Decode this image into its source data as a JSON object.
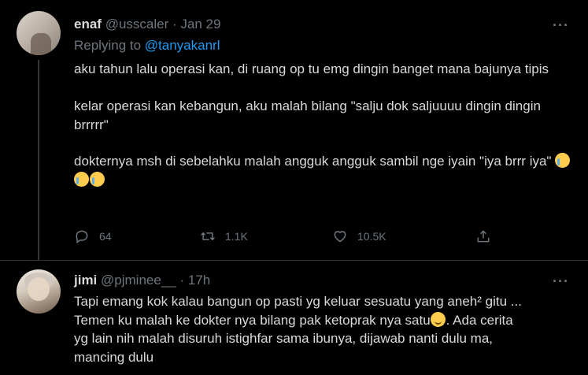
{
  "tweet1": {
    "name": "enaf",
    "handle": "@usscaler",
    "dot": "·",
    "time": "Jan 29",
    "replying_prefix": "Replying to",
    "replying_mention": "@tanyakanrl",
    "para1": "aku tahun lalu operasi kan, di ruang op tu emg dingin banget mana bajunya tipis",
    "para2": "kelar operasi kan kebangun, aku malah bilang \"salju dok saljuuuu dingin dingin brrrrr\"",
    "para3": "dokternya msh di sebelahku malah angguk angguk sambil nge iyain \"iya brrr iya\"",
    "more": "···",
    "counts": {
      "replies": "64",
      "retweets": "1.1K",
      "likes": "10.5K"
    },
    "icons": [
      "reply-icon",
      "retweet-icon",
      "like-icon",
      "share-icon",
      "loudly-crying-face-emoji"
    ]
  },
  "tweet2": {
    "name": "jimi",
    "handle": "@pjminee__",
    "dot": "·",
    "time": "17h",
    "more": "···",
    "line1": "Tapi emang kok kalau bangun op pasti yg keluar sesuatu yang aneh² gitu ...",
    "line2a": "Temen ku malah ke dokter nya bilang pak ketoprak nya satu",
    "line2b": ". Ada cerita",
    "line3": "yg lain nih malah disuruh istighfar sama ibunya, dijawab nanti dulu ma,",
    "line4": "mancing dulu",
    "icons": [
      "slightly-smiling-face-emoji"
    ]
  },
  "colors": {
    "background": "#000000",
    "text": "#d9d9d9",
    "muted": "#6e767d",
    "link": "#1d9bf0",
    "divider": "#2f3336"
  }
}
